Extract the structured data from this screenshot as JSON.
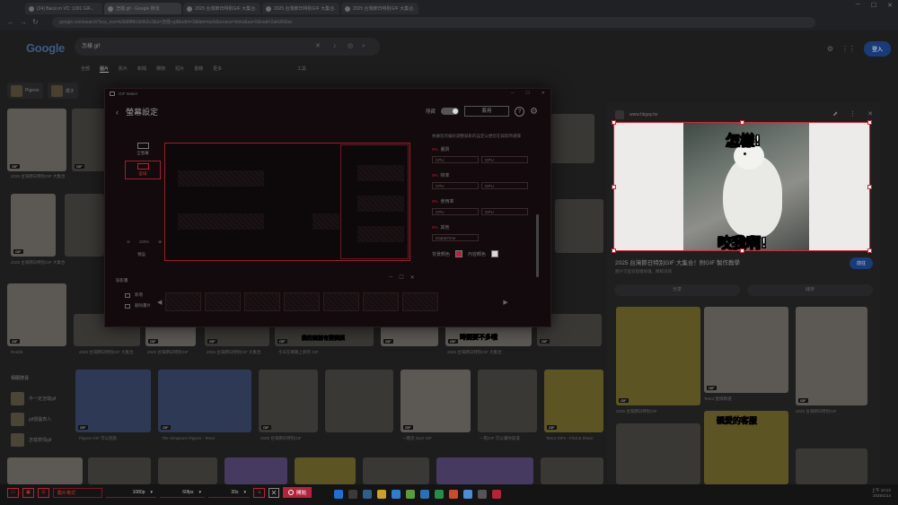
{
  "browser": {
    "tabs": [
      {
        "title": "(24) Bacio in VC: 1001 GIF..."
      },
      {
        "title": "怎樣 gif - Google 搜尋"
      },
      {
        "title": "2025 台灣節日特別GIF 大集合..."
      },
      {
        "title": "2025 台灣節日特別GIF 大集合..."
      },
      {
        "title": "2025 台灣節日特別GIF 大集合..."
      }
    ],
    "address": "google.com/search?sca_esv=b2b6ff8b1b0b3c3&q=怎樣+gif&udm=2&tbm=isch&source=lnms&sa=X&ved=2ahUKEwi"
  },
  "google": {
    "logo": "Google",
    "query": "怎樣 gif",
    "tabs": [
      "全部",
      "圖片",
      "影片",
      "新聞",
      "購物",
      "短片",
      "書籍",
      "更多"
    ],
    "tools": "工具",
    "signin": "登入",
    "chips": [
      {
        "label": "Pigeon"
      },
      {
        "label": "鴿子"
      }
    ],
    "tag": "GIF",
    "captions": {
      "c1": "2025 台灣節日特別GIF 大集合",
      "c2": "2025 台灣節日特別GIF 大集合",
      "c3": "Reddit",
      "c4": "2025 台灣節日特別GIF 大集合",
      "c5": "2025 台灣節日特別GIF",
      "c6": "2025 台灣節日特別GIF 大集合",
      "c7": "今天在網路上搞笑 GIF",
      "c8": "2025 台灣節日特別GIF 大集合",
      "c9": "The Simpsons Pigeon - Tenor",
      "c10": "2025 台灣節日特別GIF",
      "c11": "一圖流 Gym GIF",
      "c12": "一張GIF 可以讓你崩潰",
      "c13": "Pigeon GIF 可以抱抱",
      "c14": "Tenor GIFs - Find & Share"
    },
    "grid_texts": {
      "t1": "時間要不多哦",
      "t2": "我的面前有要摸摸"
    },
    "related": {
      "heading": "相關搜尋",
      "items": [
        "不一定怎樣gif",
        "gif發圖表人",
        "怎樣表情gif"
      ]
    }
  },
  "sidepanel": {
    "source": "www.hkgay.tw",
    "meme_top": "怎樣!",
    "meme_bottom": "咬我啊!",
    "title": "2025 台灣節日特別GIF 大集合！附GIF 製作教學",
    "subtitle": "圖片可能受版權保護。瞭解詳情",
    "visit": "前往",
    "actions": [
      "分享",
      "儲存"
    ],
    "grid_text": "親愛的客服",
    "grid_captions": [
      "2025 台灣節日特別GIF",
      "Tenor 愛情精選",
      "2025 台灣節日特別GIF"
    ]
  },
  "recorder": {
    "app_title": "GIF Maker",
    "title": "螢幕設定",
    "hide_label": "隱藏",
    "apply": "套用",
    "help": "?",
    "modes": [
      "全螢幕",
      "區域"
    ],
    "zoom": "100%",
    "reset": "預設",
    "scenes_label": "錄影畫",
    "scene_buttons": [
      "新增",
      "刪除畫片"
    ],
    "props_desc": "依據您的偏好調整錄影的設定以便您在錄影時選擇",
    "props": [
      {
        "label": "畫質",
        "fields": [
          "CPU",
          "GPU"
        ]
      },
      {
        "label": "幀率",
        "fields": [
          "CPU",
          "GPU"
        ]
      },
      {
        "label": "使用率",
        "fields": [
          "CPU",
          "GPU"
        ]
      },
      {
        "label": "其他",
        "fields": [
          "Date&Time"
        ]
      }
    ],
    "prop_flag": "0%",
    "colors": {
      "bg_label": "背景顏色",
      "fg_label": "內容顏色",
      "bg": "#b5223a",
      "fg": "#d9d9d9"
    }
  },
  "toolbar": {
    "format": "動片格式",
    "resolution": "1080p",
    "fps": "60fps",
    "duration": "30s",
    "start": "開始"
  },
  "tray": {
    "time": "上午 10:22",
    "date": "2025/1/14"
  },
  "accent": "#b5223a"
}
